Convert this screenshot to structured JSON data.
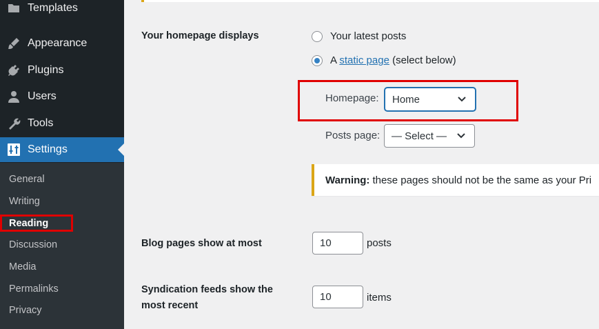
{
  "sidebar": {
    "items": [
      {
        "label": "Templates",
        "icon": "folder-icon"
      },
      {
        "label": "Appearance",
        "icon": "paintbrush-icon"
      },
      {
        "label": "Plugins",
        "icon": "plugin-icon"
      },
      {
        "label": "Users",
        "icon": "users-icon"
      },
      {
        "label": "Tools",
        "icon": "wrench-icon"
      },
      {
        "label": "Settings",
        "icon": "settings-sliders-icon"
      }
    ],
    "submenu": [
      "General",
      "Writing",
      "Reading",
      "Discussion",
      "Media",
      "Permalinks",
      "Privacy"
    ],
    "current_submenu": "Reading"
  },
  "reading": {
    "homepage_displays_label": "Your homepage displays",
    "option_latest": "Your latest posts",
    "option_static_prefix": "A",
    "option_static_link": "static page",
    "option_static_suffix": "(select below)",
    "homepage_label": "Homepage:",
    "homepage_value": "Home",
    "posts_page_label": "Posts page:",
    "posts_page_value": "— Select —",
    "warning_strong": "Warning:",
    "warning_text": "these pages should not be the same as your Pri",
    "blog_pages_label": "Blog pages show at most",
    "blog_pages_value": "10",
    "blog_pages_unit": "posts",
    "syndication_label_line1": "Syndication feeds show the",
    "syndication_label_line2": "most recent",
    "syndication_value": "10",
    "syndication_unit": "items"
  },
  "colors": {
    "sidebar_bg": "#1d2327",
    "submenu_bg": "#2c3338",
    "accent": "#2271b1",
    "highlight": "#e00000",
    "warning": "#dba617"
  }
}
